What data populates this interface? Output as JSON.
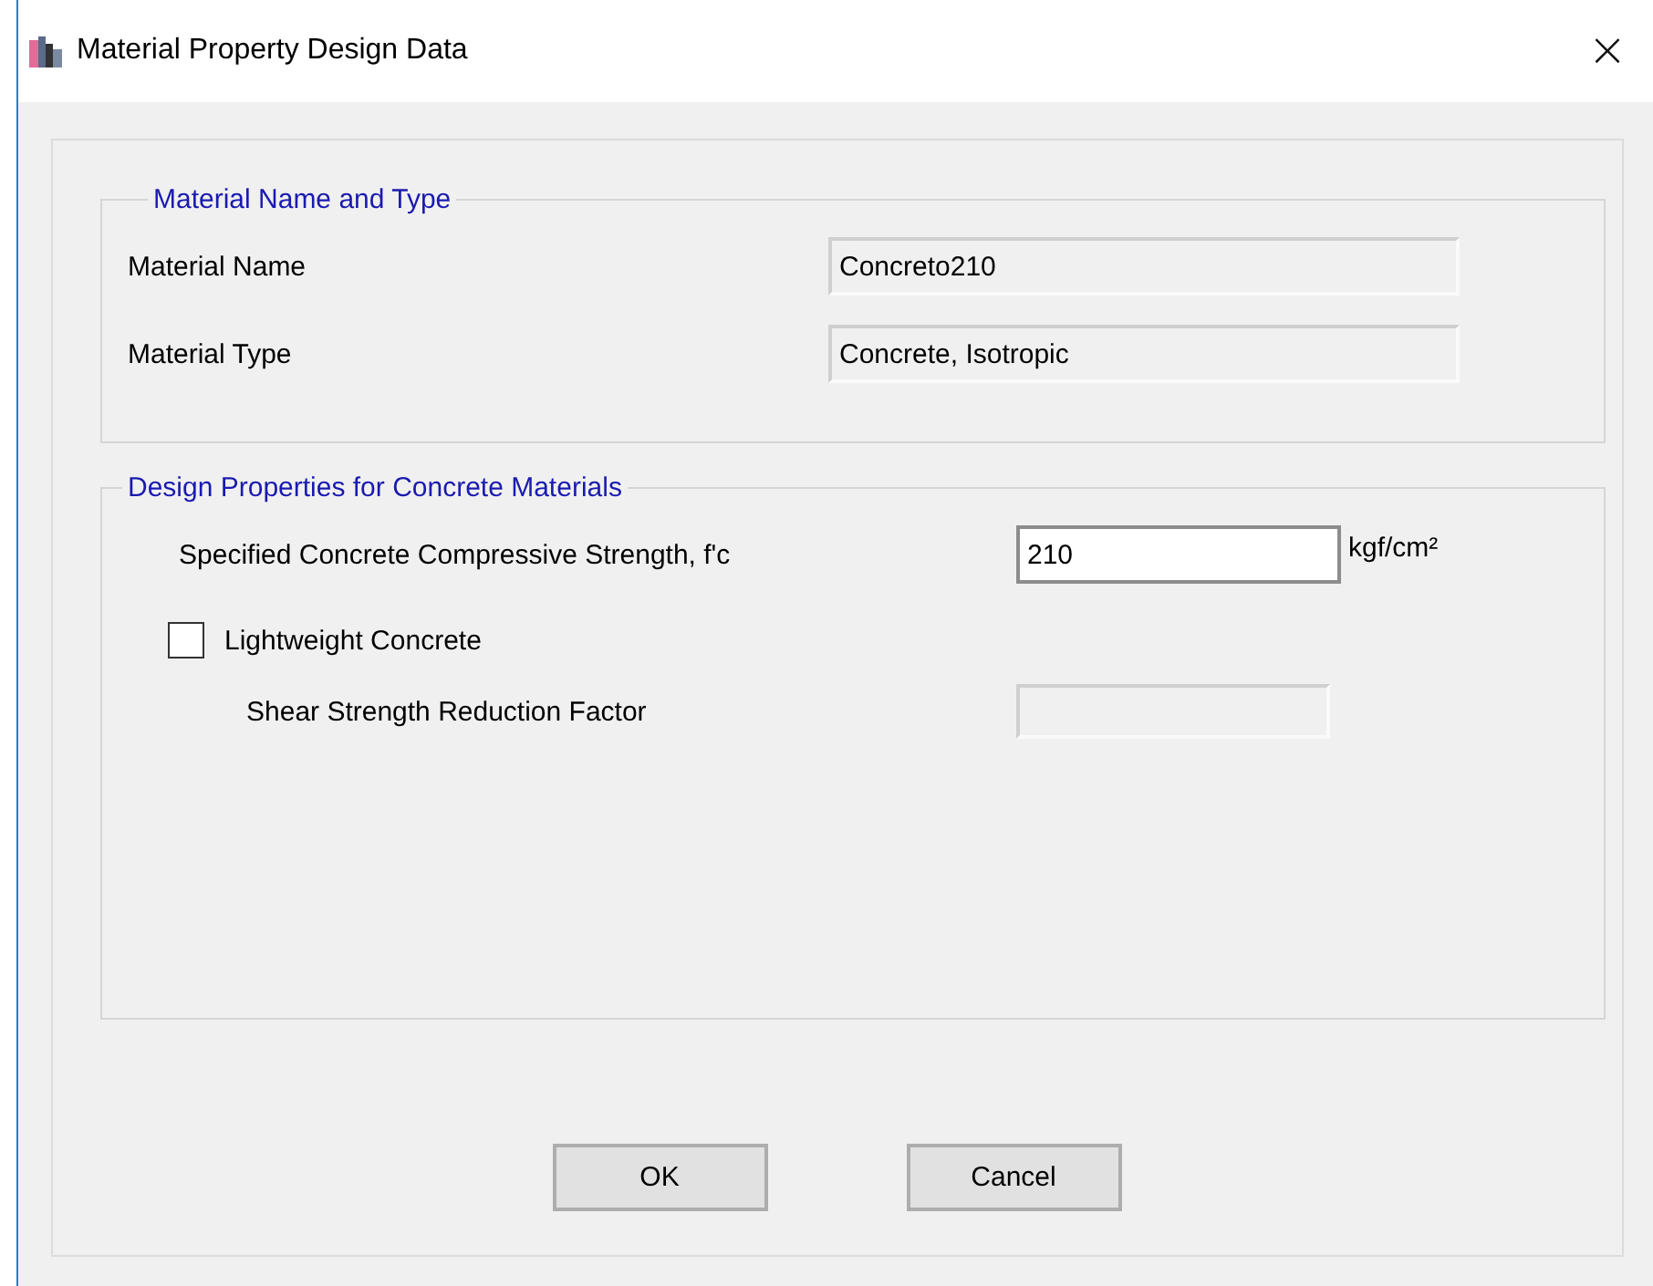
{
  "window": {
    "title": "Material Property Design Data",
    "close": "×"
  },
  "material_group": {
    "title": "Material Name and Type",
    "fields": [
      {
        "label": "Material Name",
        "value": "Concreto210",
        "disabled": true
      },
      {
        "label": "Material Type",
        "value": "Concrete, Isotropic",
        "disabled": true
      }
    ]
  },
  "design_group": {
    "title": "Design Properties for Concrete Materials",
    "strength": {
      "label": "Specified Concrete Compressive Strength, f'c",
      "value": "210",
      "unit": "kgf/cm²",
      "disabled": false
    },
    "lightweight": {
      "label": "Lightweight Concrete",
      "checked": false
    },
    "shear": {
      "label": "Shear Strength Reduction Factor",
      "disabled": true
    }
  },
  "buttons": [
    "OK",
    "Cancel"
  ]
}
